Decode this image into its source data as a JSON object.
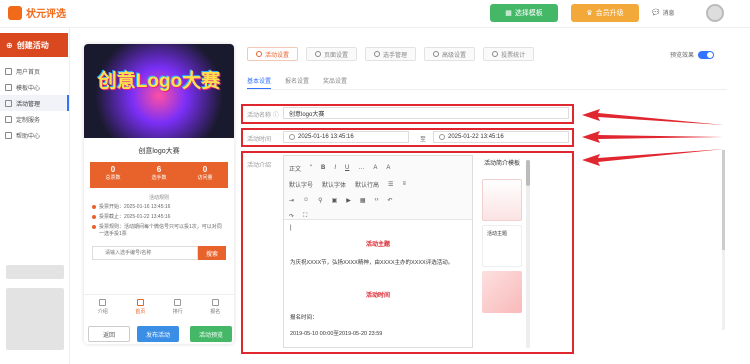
{
  "brand": {
    "name": "状元评选",
    "color": "#f06a1a"
  },
  "topbar": {
    "template_button": "选择模板",
    "vip_button": "会员升级",
    "message_label": "消息"
  },
  "sidebar": {
    "create_button": "创建活动",
    "items": [
      {
        "label": "用户首页",
        "icon": "home-icon"
      },
      {
        "label": "模板中心",
        "icon": "template-icon"
      },
      {
        "label": "活动管理",
        "icon": "list-icon",
        "active": true
      },
      {
        "label": "定制服务",
        "icon": "custom-icon"
      },
      {
        "label": "帮助中心",
        "icon": "help-icon"
      }
    ]
  },
  "preview": {
    "banner_text": "创意Logo大赛",
    "title": "创意logo大赛",
    "stats": [
      {
        "value": "0",
        "label": "总票数"
      },
      {
        "value": "6",
        "label": "选手数"
      },
      {
        "value": "0",
        "label": "访问量"
      }
    ],
    "rules_heading": "活动规则",
    "lines": [
      "投票开始：2025-01-16 13:45:16",
      "投票截止：2025-01-22 13:45:16",
      "投票规则：活动期间每个微信号只可以投1次，可以对同一选手投1票"
    ],
    "search_placeholder": "请输入选手编号/名称",
    "search_button": "搜索",
    "nav": [
      "介绍",
      "首页",
      "排行",
      "报名"
    ],
    "nav_active_index": 1
  },
  "actions": {
    "back": "返回",
    "publish": "发布活动",
    "preview": "活动预览"
  },
  "tabs": [
    "活动设置",
    "页面设置",
    "选手管理",
    "高级设置",
    "投票统计"
  ],
  "toggle_label": "预览效果",
  "subtabs": [
    "基本设置",
    "报名设置",
    "奖品设置"
  ],
  "form": {
    "name_label": "活动名称",
    "name_value": "创意logo大赛",
    "time_label": "活动时间",
    "start_time": "2025-01-16 13:45:16",
    "time_separator": "至",
    "end_time": "2025-01-22 13:45:16",
    "intro_label": "活动介绍"
  },
  "editor": {
    "toolbar_row1": [
      "正文",
      "“",
      "B",
      "I",
      "U",
      "…",
      "A",
      "A"
    ],
    "toolbar_row2": [
      "默认字号",
      "默认字体",
      "默认行高"
    ],
    "content": {
      "heading1": "活动主题",
      "text1": "为庆祝XXXX节，弘扬XXXX精神，由XXXX主办的XXXX评选活动。",
      "heading2": "活动时间",
      "text2": "报名时间：",
      "text3": "2019-05-10 00:00至2019-05-20 23:59"
    }
  },
  "template_panel": {
    "title": "活动简介模板",
    "card_label": "活动主题"
  },
  "colors": {
    "accent": "#e8632c",
    "highlight": "#e0262e",
    "link": "#3273ff"
  }
}
